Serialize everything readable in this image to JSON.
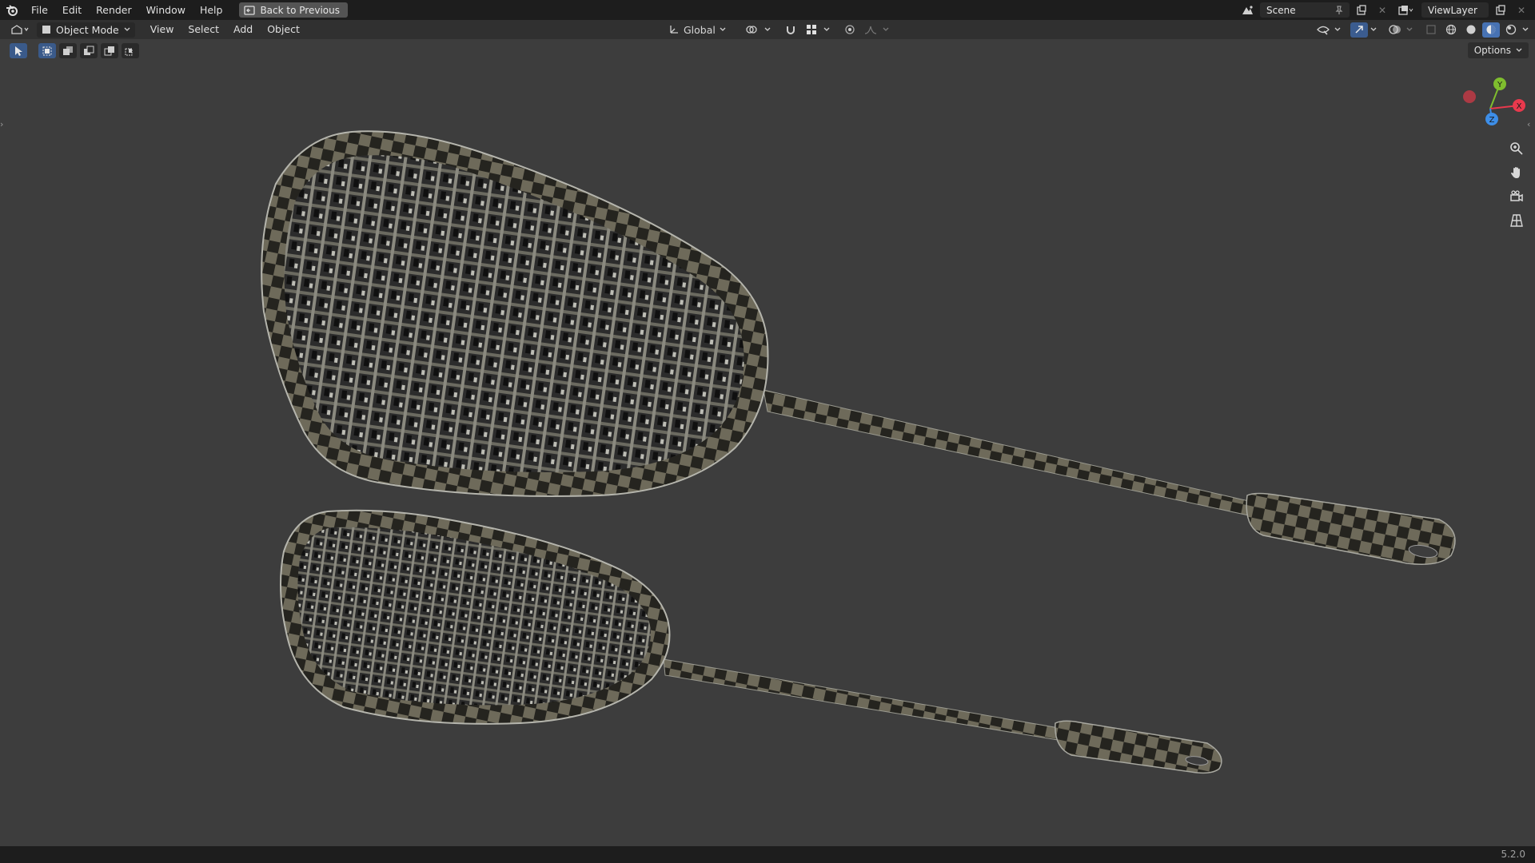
{
  "topbar": {
    "menus": [
      "File",
      "Edit",
      "Render",
      "Window",
      "Help"
    ],
    "back_label": "Back to Previous",
    "scene": "Scene",
    "view_layer": "ViewLayer"
  },
  "header": {
    "mode": "Object Mode",
    "menus": [
      "View",
      "Select",
      "Add",
      "Object"
    ],
    "transform_orientation": "Global"
  },
  "viewport": {
    "options_label": "Options",
    "gizmo_axes": [
      "Z",
      "Y",
      "X"
    ]
  },
  "status": {
    "version": "5.2.0"
  },
  "colors": {
    "top_bar": "#1d1d1d",
    "header": "#303030",
    "viewport_bg": "#3d3d3d",
    "active_blue": "#4772b3",
    "axis_x": "#e8394d",
    "axis_y": "#7fbe2e",
    "axis_z": "#3d8ee8"
  }
}
